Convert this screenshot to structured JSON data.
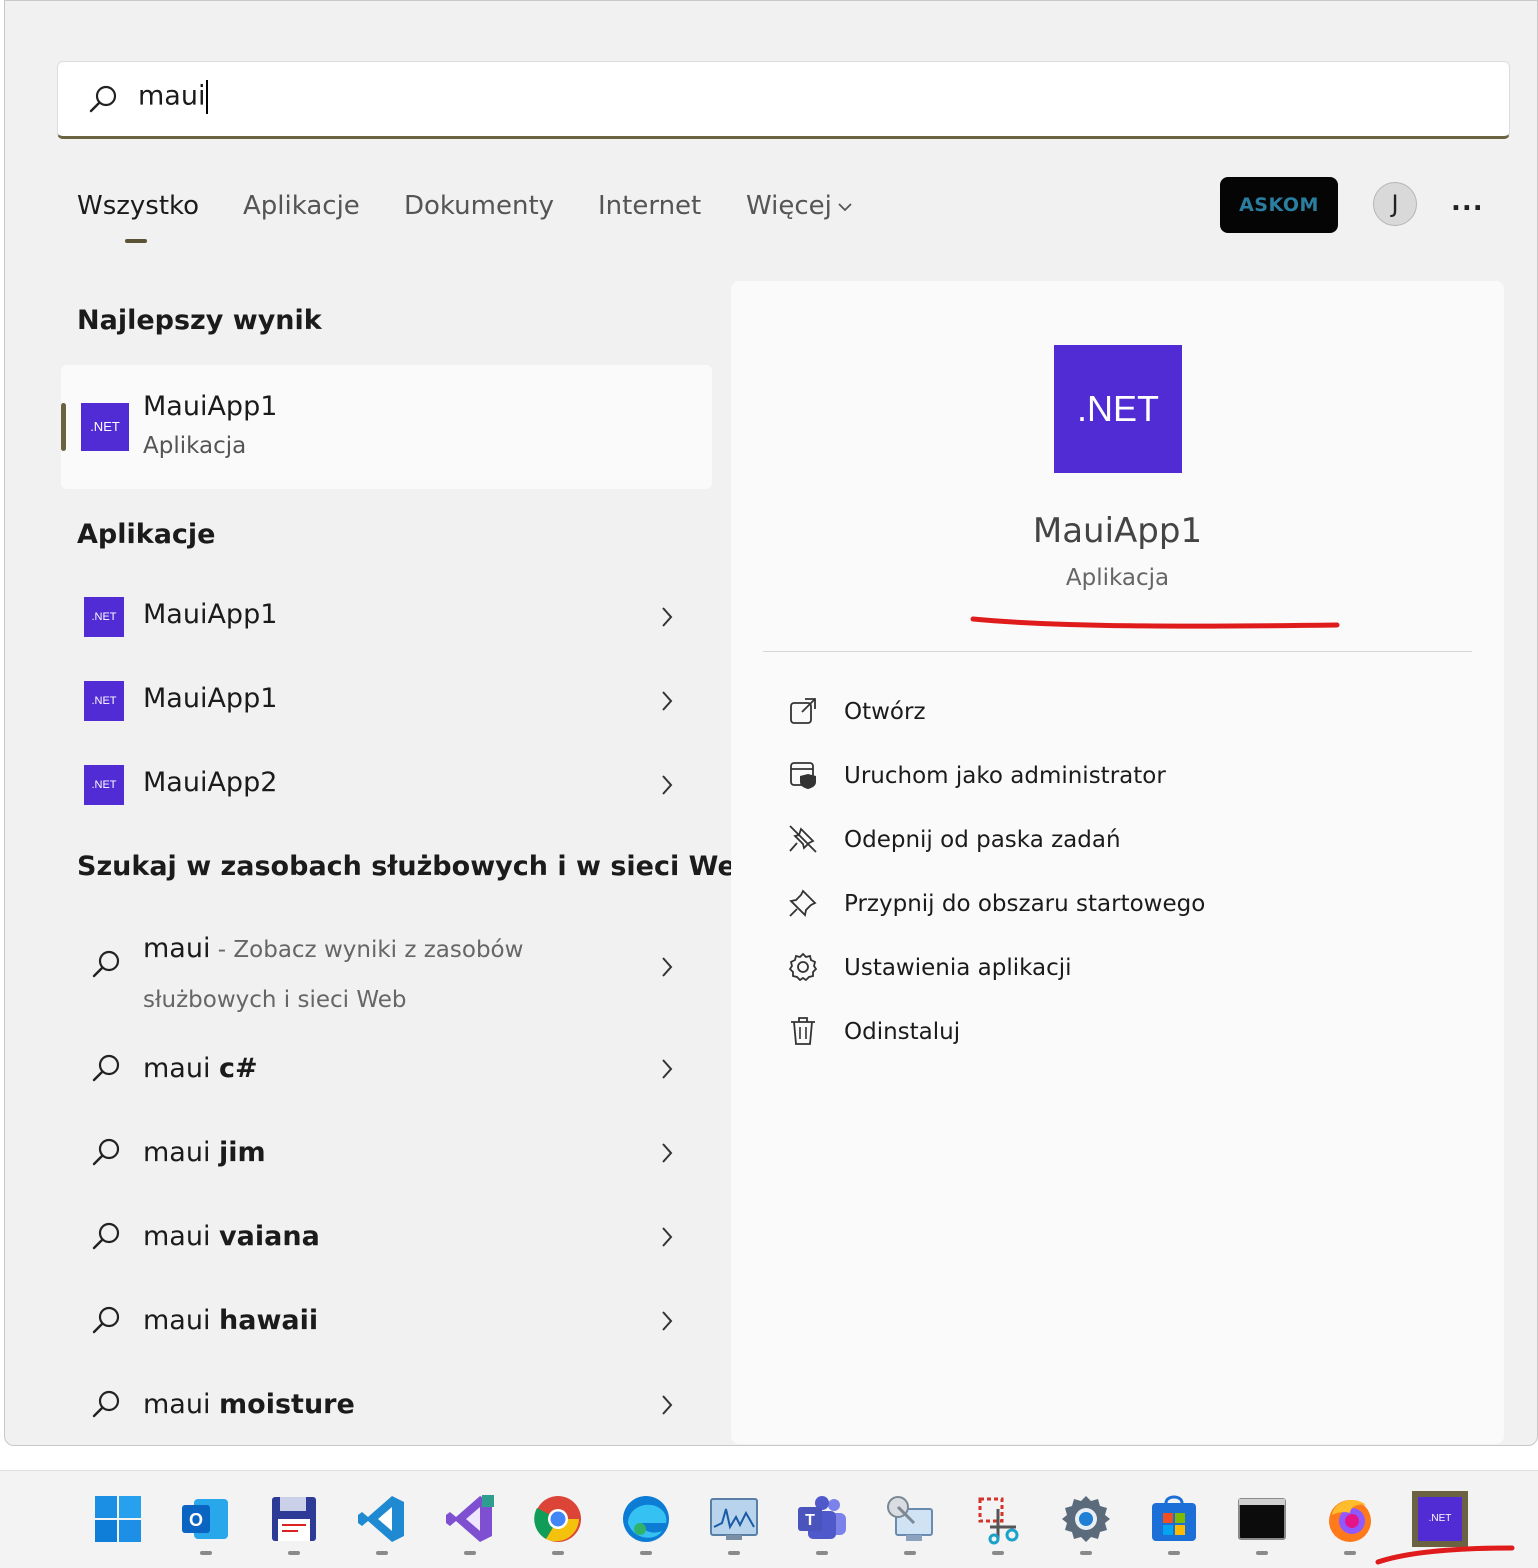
{
  "search": {
    "value": "maui"
  },
  "tabs": [
    {
      "label": "Wszystko",
      "active": true
    },
    {
      "label": "Aplikacje"
    },
    {
      "label": "Dokumenty"
    },
    {
      "label": "Internet"
    },
    {
      "label": "Więcej"
    }
  ],
  "header": {
    "org_badge": "ASKOM",
    "avatar_initial": "J",
    "more_label": "..."
  },
  "best_match": {
    "heading": "Najlepszy wynik",
    "icon_text": ".NET",
    "title": "MauiApp1",
    "subtitle": "Aplikacja"
  },
  "apps": {
    "heading": "Aplikacje",
    "items": [
      {
        "icon_text": ".NET",
        "label": "MauiApp1"
      },
      {
        "icon_text": ".NET",
        "label": "MauiApp1"
      },
      {
        "icon_text": ".NET",
        "label": "MauiApp2"
      }
    ]
  },
  "web": {
    "heading": "Szukaj w zasobach służbowych i w sieci Web",
    "first": {
      "query": "maui",
      "desc_line1": " - Zobacz wyniki z zasobów",
      "desc_line2": "służbowych i sieci Web"
    },
    "items": [
      {
        "prefix": "maui ",
        "bold": "c#"
      },
      {
        "prefix": "maui ",
        "bold": "jim"
      },
      {
        "prefix": "maui ",
        "bold": "vaiana"
      },
      {
        "prefix": "maui ",
        "bold": "hawaii"
      },
      {
        "prefix": "maui ",
        "bold": "moisture"
      }
    ]
  },
  "detail": {
    "icon_text": ".NET",
    "name": "MauiApp1",
    "kind": "Aplikacja",
    "actions": [
      {
        "label": "Otwórz",
        "icon": "open-external-icon"
      },
      {
        "label": "Uruchom jako administrator",
        "icon": "shield-run-admin-icon"
      },
      {
        "label": "Odepnij od paska zadań",
        "icon": "unpin-icon"
      },
      {
        "label": "Przypnij do obszaru startowego",
        "icon": "pin-icon"
      },
      {
        "label": "Ustawienia aplikacji",
        "icon": "gear-icon"
      },
      {
        "label": "Odinstaluj",
        "icon": "trash-icon"
      }
    ]
  },
  "taskbar": {
    "items": [
      {
        "name": "start-icon"
      },
      {
        "name": "outlook-icon"
      },
      {
        "name": "save-disk-icon"
      },
      {
        "name": "vscode-icon"
      },
      {
        "name": "visual-studio-icon"
      },
      {
        "name": "chrome-icon"
      },
      {
        "name": "edge-icon"
      },
      {
        "name": "performance-monitor-icon"
      },
      {
        "name": "teams-icon"
      },
      {
        "name": "remote-desktop-icon"
      },
      {
        "name": "snipping-tool-icon"
      },
      {
        "name": "settings-icon"
      },
      {
        "name": "store-icon"
      },
      {
        "name": "terminal-icon"
      },
      {
        "name": "firefox-icon"
      },
      {
        "name": "dotnet-app-icon",
        "label": ".NET"
      }
    ]
  },
  "colors": {
    "dotnet_purple": "#512bd4",
    "accent": "#6b6242",
    "annotation_red": "#e01b1b"
  }
}
